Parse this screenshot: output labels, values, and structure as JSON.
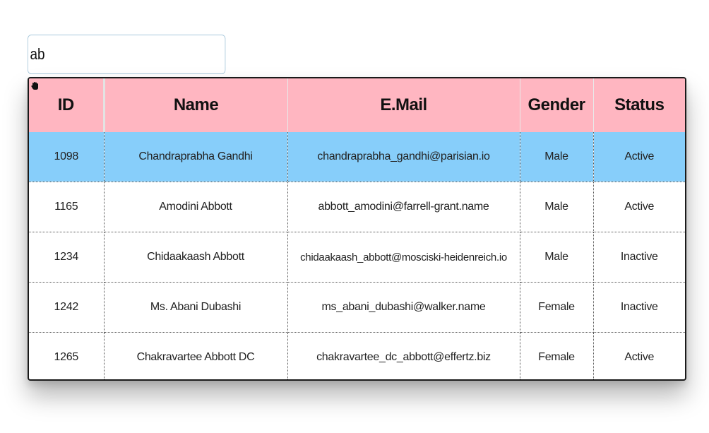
{
  "search": {
    "value": "ab"
  },
  "grid": {
    "columns": [
      "ID",
      "Name",
      "E.Mail",
      "Gender",
      "Status"
    ],
    "rows": [
      {
        "id": "1098",
        "name": "Chandraprabha Gandhi",
        "email": "chandraprabha_gandhi@parisian.io",
        "gender": "Male",
        "status": "Active",
        "selected": true
      },
      {
        "id": "1165",
        "name": "Amodini Abbott",
        "email": "abbott_amodini@farrell-grant.name",
        "gender": "Male",
        "status": "Active",
        "selected": false
      },
      {
        "id": "1234",
        "name": "Chidaakaash Abbott",
        "email": "chidaakaash_abbott@mosciski-heidenreich.io",
        "gender": "Male",
        "status": "Inactive",
        "selected": false
      },
      {
        "id": "1242",
        "name": "Ms. Abani Dubashi",
        "email": "ms_abani_dubashi@walker.name",
        "gender": "Female",
        "status": "Inactive",
        "selected": false
      },
      {
        "id": "1265",
        "name": "Chakravartee Abbott DC",
        "email": "chakravartee_dc_abbott@effertz.biz",
        "gender": "Female",
        "status": "Active",
        "selected": false
      }
    ]
  },
  "colors": {
    "header_bg": "#ffb6c1",
    "selected_row_bg": "#87cefa"
  },
  "icons": {
    "drag_handle": "hand-grab-icon"
  }
}
